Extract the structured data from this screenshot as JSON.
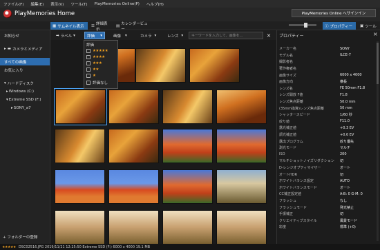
{
  "menu": [
    "ファイル(F)",
    "編集(E)",
    "表示(V)",
    "ツール(T)",
    "PlayMemories Online(P)",
    "ヘルプ(H)"
  ],
  "app_title": "PlayMemories Home",
  "online_button": "PlayMemories Online へサインイン",
  "toolbar": {
    "thumbnail": "サムネイル表示",
    "detail": "詳細表示",
    "calendar": "カレンダービュー",
    "properties": "プロパティー",
    "tools": "ツール"
  },
  "left": {
    "notice": "お知らせ",
    "camera_media": "カメラとメディア",
    "all_images": "すべての画像",
    "favorites": "お気に入り",
    "hard_disk": "ハードディスク",
    "drive_c": "Windows (C:)",
    "drive_f": "Extreme SSD (F:)",
    "folder": "SONY_a7",
    "add_folder": "フォルダーの登録"
  },
  "filter": {
    "label": "ラベル",
    "rating": "評価",
    "image": "画像",
    "camera": "カメラ",
    "lens": "レンズ",
    "search_placeholder": "キーワードを入力して、画像を..."
  },
  "rating_dropdown": {
    "title": "評価",
    "items": [
      "★★★★★",
      "★★★★",
      "★★★",
      "★★",
      "★"
    ],
    "none": "評価なし"
  },
  "properties": {
    "title": "プロパティー",
    "rows": [
      [
        "メーカー名",
        "SONY"
      ],
      [
        "モデル名",
        "ILCE-7"
      ],
      [
        "撮影者名",
        ""
      ],
      [
        "著作権者名",
        ""
      ],
      [
        "画像サイズ",
        "6000 x 4000"
      ],
      [
        "画像方向",
        "横長"
      ],
      [
        "レンズ名",
        "FE 50mm F1.8"
      ],
      [
        "レンズ開放 F値",
        "F1.8"
      ],
      [
        "レンズ焦点距離",
        "50.0 mm"
      ],
      [
        "(35mm換算)レンズ焦点距離",
        "50 mm"
      ],
      [
        "シャッタースピード",
        "1/60 秒"
      ],
      [
        "絞り値",
        "F11.0"
      ],
      [
        "露光補正値",
        "+0.3 EV"
      ],
      [
        "調光補正値",
        "+0.0 EV"
      ],
      [
        "露出プログラム",
        "絞り優先"
      ],
      [
        "測光モード",
        "マルチ"
      ],
      [
        "ISO",
        "200"
      ],
      [
        "マルチショットノイズリダクション",
        "切"
      ],
      [
        "D-レンジオプティマイザー",
        "オート"
      ],
      [
        "オートHDR",
        "切"
      ],
      [
        "ホワイトバランス設定",
        "AUTO"
      ],
      [
        "ホワイトバランスモード",
        "オート"
      ],
      [
        "CC補正設定値",
        "A-B: 0 G-M: 0"
      ],
      [
        "フラッシュ",
        "なし"
      ],
      [
        "フラッシュモード",
        "発光禁止"
      ],
      [
        "手振補正",
        "切"
      ],
      [
        "クリエイティブスタイル",
        "風景モード"
      ],
      [
        "彩度",
        "標準 (+0)"
      ]
    ]
  },
  "status": {
    "stars": "★★★★★",
    "text": "DSC02516.JPG 2019/11/21 12:25:50 Extreme SSD (F:) 6000 x 4000 19.1 MB"
  },
  "colors": {
    "accent": "#2d6db0",
    "star": "#f0a020"
  }
}
